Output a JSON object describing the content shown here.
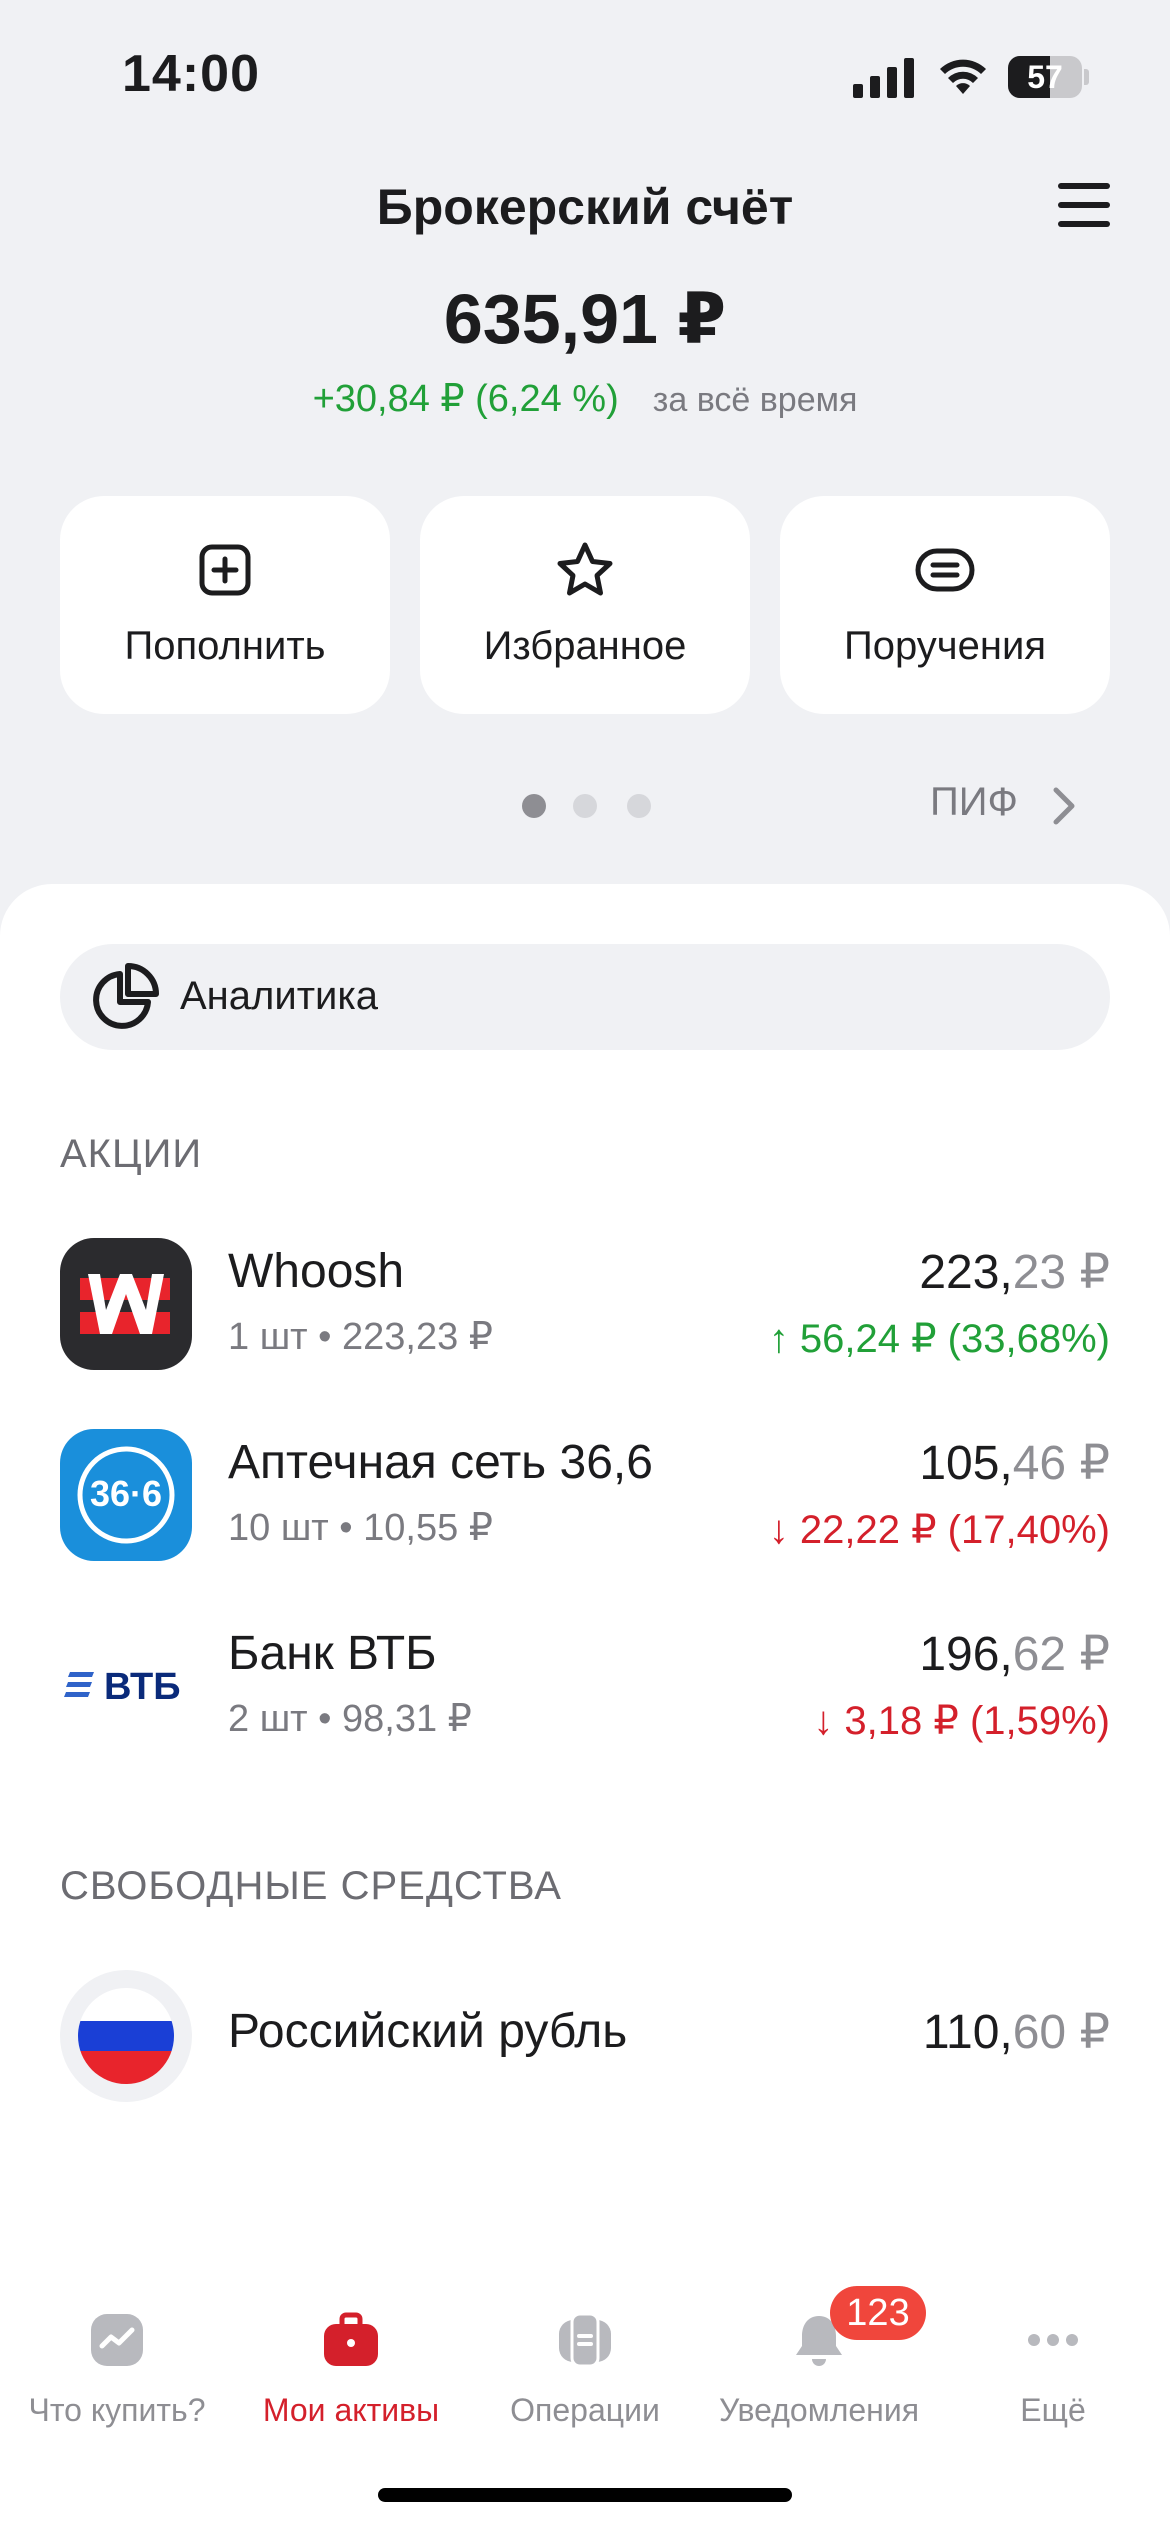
{
  "status_bar": {
    "time": "14:00",
    "battery_text": "57",
    "battery_level": 0.57
  },
  "header": {
    "title": "Брокерский счёт"
  },
  "summary": {
    "balance": "635,91 ₽",
    "change": "+30,84 ₽ (6,24 %)",
    "change_period": "за всё время"
  },
  "actions": [
    {
      "label": "Пополнить",
      "icon": "plus-square-icon"
    },
    {
      "label": "Избранное",
      "icon": "star-icon"
    },
    {
      "label": "Поручения",
      "icon": "orders-icon"
    }
  ],
  "pager": {
    "pages": 3,
    "active": 0,
    "link_label": "ПИФ"
  },
  "analytics": {
    "label": "Аналитика",
    "icon": "pie-chart-icon"
  },
  "stocks_section": {
    "title": "АКЦИИ"
  },
  "stocks": [
    {
      "name": "Whoosh",
      "sub": "1 шт • 223,23 ₽",
      "value_int": "223,",
      "value_frac": "23 ₽",
      "change": "↑ 56,24 ₽ (33,68%)",
      "direction": "up",
      "logo": "whoosh-logo"
    },
    {
      "name": "Аптечная сеть 36,6",
      "sub": "10 шт • 10,55 ₽",
      "value_int": "105,",
      "value_frac": "46 ₽",
      "change": "↓ 22,22 ₽ (17,40%)",
      "direction": "down",
      "logo": "apteka-366-logo",
      "logo_text": "36·6"
    },
    {
      "name": "Банк ВТБ",
      "sub": "2 шт • 98,31 ₽",
      "value_int": "196,",
      "value_frac": "62 ₽",
      "change": "↓ 3,18 ₽ (1,59%)",
      "direction": "down",
      "logo": "vtb-logo",
      "logo_text": "ВТБ"
    }
  ],
  "cash_section": {
    "title": "СВОБОДНЫЕ СРЕДСТВА"
  },
  "cash": [
    {
      "name": "Российский рубль",
      "value_int": "110,",
      "value_frac": "60 ₽",
      "logo": "russia-flag-icon"
    }
  ],
  "bottom_nav": [
    {
      "label": "Что купить?",
      "icon": "chart-icon",
      "active": false
    },
    {
      "label": "Мои активы",
      "icon": "briefcase-icon",
      "active": true
    },
    {
      "label": "Операции",
      "icon": "operations-icon",
      "active": false
    },
    {
      "label": "Уведомления",
      "icon": "bell-icon",
      "active": false,
      "badge": "123"
    },
    {
      "label": "Ещё",
      "icon": "more-icon",
      "active": false
    }
  ],
  "colors": {
    "positive": "#21a038",
    "negative": "#d4202b",
    "accent": "#d4202b",
    "background": "#f0f1f4"
  }
}
